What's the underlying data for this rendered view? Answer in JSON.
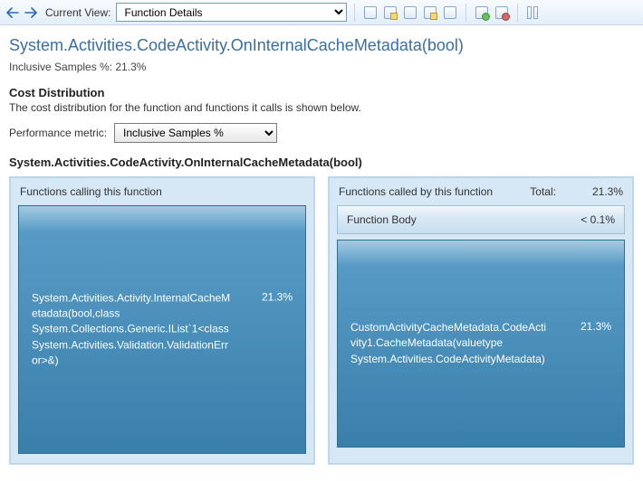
{
  "toolbar": {
    "viewLabel": "Current View:",
    "viewValue": "Function Details"
  },
  "header": {
    "functionName": "System.Activities.CodeActivity.OnInternalCacheMetadata(bool)",
    "inclusiveLine": "Inclusive Samples %: 21.3%"
  },
  "costDist": {
    "title": "Cost Distribution",
    "desc": "The cost distribution for the function and functions it calls is shown below."
  },
  "metric": {
    "label": "Performance metric:",
    "value": "Inclusive Samples %"
  },
  "fnBold": "System.Activities.CodeActivity.OnInternalCacheMetadata(bool)",
  "left": {
    "header": "Functions calling this function",
    "caller": "System.Activities.Activity.InternalCacheMetadata(bool,class System.Collections.Generic.IList`1<class System.Activities.Validation.ValidationError>&)",
    "callerPct": "21.3%"
  },
  "right": {
    "header": "Functions called by this function",
    "totalLabel": "Total:",
    "totalPct": "21.3%",
    "bodyLabel": "Function Body",
    "bodyPct": "< 0.1%",
    "callee": "CustomActivityCacheMetadata.CodeActivity1.CacheMetadata(valuetype System.Activities.CodeActivityMetadata)",
    "calleePct": "21.3%"
  }
}
